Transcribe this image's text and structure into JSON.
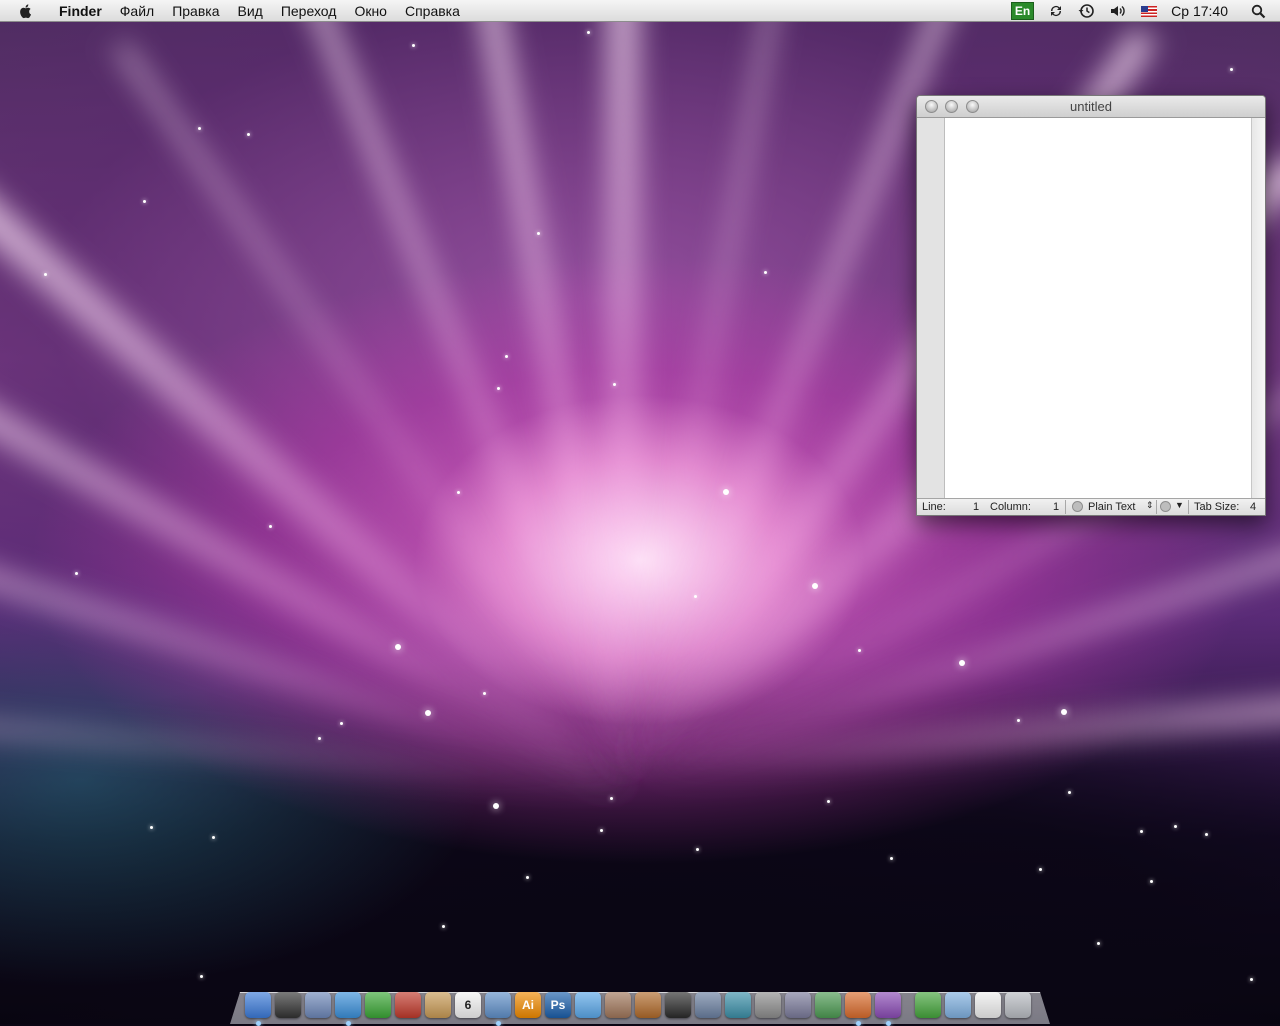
{
  "menubar": {
    "app_name": "Finder",
    "items": [
      "Файл",
      "Правка",
      "Вид",
      "Переход",
      "Окно",
      "Справка"
    ],
    "extras": {
      "input_language": "En",
      "clock": "Ср 17:40"
    }
  },
  "window": {
    "title": "untitled",
    "status": {
      "line_label": "Line:",
      "line_value": "1",
      "column_label": "Column:",
      "column_value": "1",
      "format": "Plain Text",
      "tab_size_label": "Tab Size:",
      "tab_size_value": "4"
    }
  },
  "dock": {
    "apps": [
      {
        "icon": "finder-icon",
        "color": "#3b7ad8",
        "running": true
      },
      {
        "icon": "dashboard-icon",
        "color": "#333333"
      },
      {
        "icon": "xcode-icon",
        "color": "#6d87b8"
      },
      {
        "icon": "safari-icon",
        "color": "#3a8fd9",
        "running": true
      },
      {
        "icon": "adium-icon",
        "color": "#3aa635"
      },
      {
        "icon": "stamp-app-icon",
        "color": "#c0392b"
      },
      {
        "icon": "address-book-icon",
        "color": "#c89a55"
      },
      {
        "icon": "ical-icon",
        "color": "#f2f2f2",
        "text": "6"
      },
      {
        "icon": "preview-icon",
        "color": "#5f8fc8",
        "running": true
      },
      {
        "icon": "illustrator-icon",
        "color": "#f08a00",
        "text": "Ai"
      },
      {
        "icon": "photoshop-icon",
        "color": "#1b5fab",
        "text": "Ps"
      },
      {
        "icon": "itunes-icon",
        "color": "#5aa7e8"
      },
      {
        "icon": "iphoto-icon",
        "color": "#a0765a"
      },
      {
        "icon": "garageband-icon",
        "color": "#b06a2a"
      },
      {
        "icon": "dvd-player-icon",
        "color": "#2b2b2b"
      },
      {
        "icon": "spaces-icon",
        "color": "#6a7fa0"
      },
      {
        "icon": "time-machine-icon",
        "color": "#3b8fa8"
      },
      {
        "icon": "system-preferences-icon",
        "color": "#8c8c8c"
      },
      {
        "icon": "script-editor-icon",
        "color": "#7a7a9a"
      },
      {
        "icon": "activity-monitor-icon",
        "color": "#4c9a52"
      },
      {
        "icon": "keynote-icon",
        "color": "#d96b2c",
        "running": true
      },
      {
        "icon": "pages-icon",
        "color": "#8a4bb5",
        "running": true
      },
      {
        "icon": "downloads-stack-icon",
        "color": "#45a53c",
        "gap": true
      },
      {
        "icon": "folder-stack-icon",
        "color": "#7fb0e0"
      },
      {
        "icon": "document-stack-icon",
        "color": "#eeeeee"
      },
      {
        "icon": "trash-icon",
        "color": "#b8bcc2"
      }
    ]
  }
}
